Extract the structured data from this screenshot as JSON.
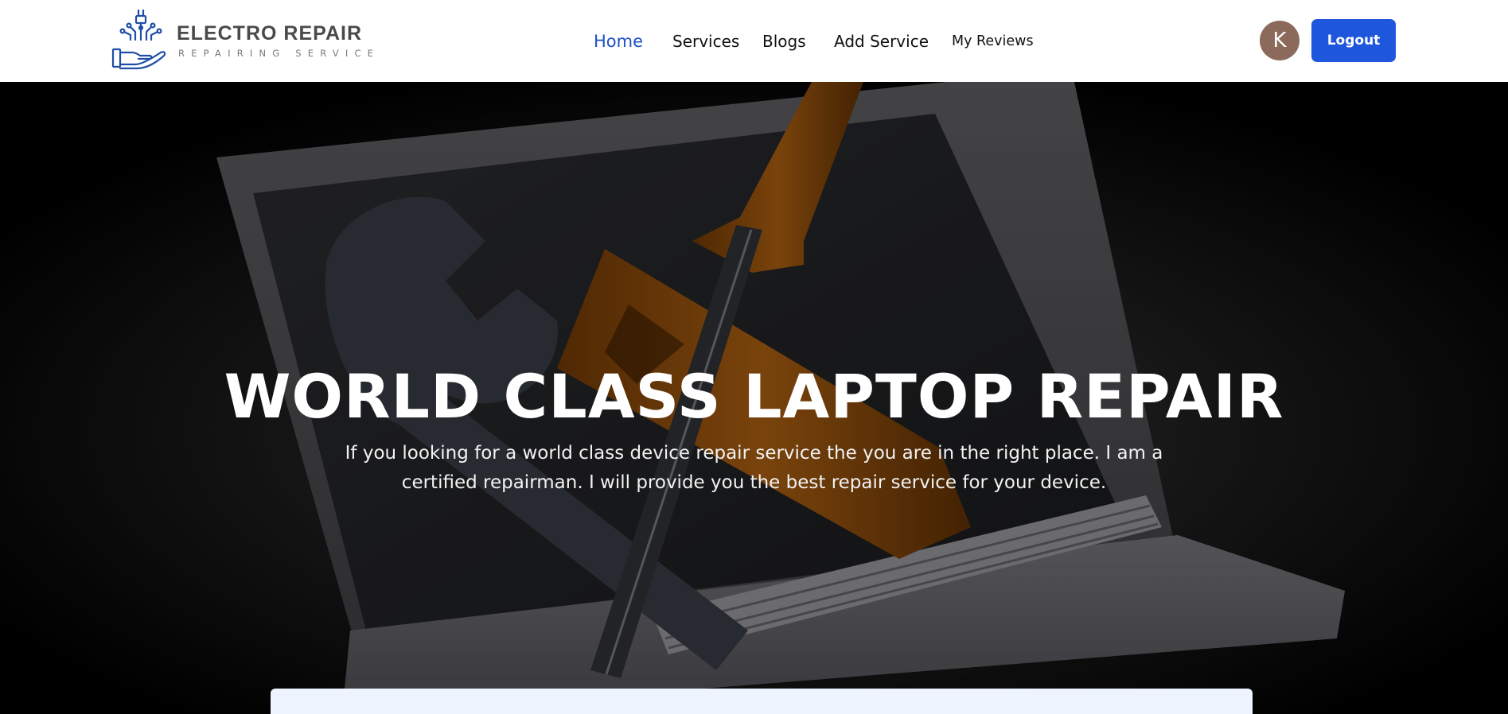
{
  "brand": {
    "title": "ELECTRO REPAIR",
    "subtitle": "REPAIRING SERVICE",
    "icon": "hand-circuit-plug-icon",
    "color": "#1f4ea8"
  },
  "nav": {
    "items": [
      {
        "label": "Home",
        "active": true
      },
      {
        "label": "Services"
      },
      {
        "label": "Blogs"
      },
      {
        "label": "Add Service"
      },
      {
        "label": "My Reviews"
      }
    ],
    "active_color": "#1e50c8"
  },
  "user": {
    "avatar_initial": "K",
    "avatar_color": "#8c6a5b",
    "logout_label": "Logout",
    "logout_color": "#1f57dc"
  },
  "hero": {
    "title": "WORLD CLASS LAPTOP REPAIR",
    "description": "If you looking for a world class device repair service the you are in the right place. I am a certified repairman. I will provide you the best repair service for your device.",
    "background_image": "laptop-with-wrench-and-screwdriver"
  }
}
